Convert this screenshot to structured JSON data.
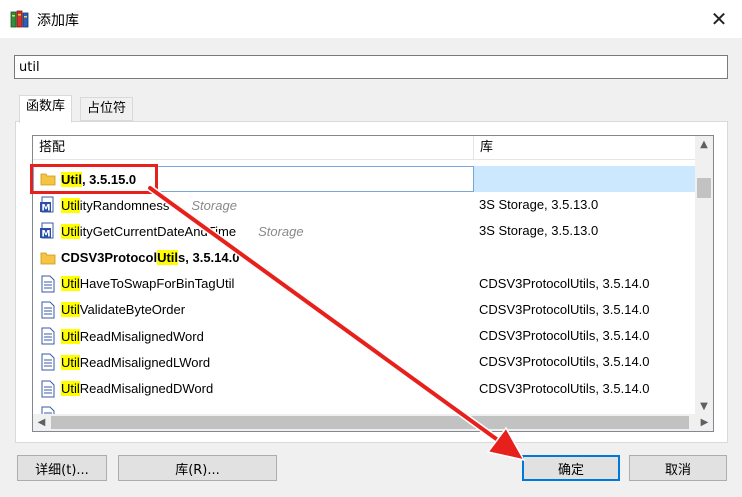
{
  "window": {
    "title": "添加库",
    "close_glyph": "✕",
    "icon": "books-icon"
  },
  "search": {
    "value": "util",
    "placeholder": ""
  },
  "tabs": [
    {
      "label": "函数库",
      "active": true
    },
    {
      "label": "占位符",
      "active": false
    }
  ],
  "list": {
    "columns": {
      "match": "搭配",
      "library": "库"
    },
    "rows": [
      {
        "icon": "folder-icon",
        "pre": "",
        "hl": "Util",
        "post": ", 3.5.15.0",
        "bold": true,
        "hint": "",
        "lib": "",
        "selected": true
      },
      {
        "icon": "method-icon",
        "pre": "",
        "hl": "Util",
        "post": "ityRandomness",
        "bold": false,
        "hint": "Storage",
        "lib": "3S Storage, 3.5.13.0",
        "selected": false
      },
      {
        "icon": "method-icon",
        "pre": "",
        "hl": "Util",
        "post": "ityGetCurrentDateAndTime",
        "bold": false,
        "hint": "Storage",
        "lib": "3S Storage, 3.5.13.0",
        "selected": false
      },
      {
        "icon": "folder-icon",
        "pre": "CDSV3Protocol",
        "hl": "Util",
        "post": "s, 3.5.14.0",
        "bold": true,
        "hint": "",
        "lib": "",
        "selected": false
      },
      {
        "icon": "document-icon",
        "pre": "",
        "hl": "Util",
        "post": "HaveToSwapForBinTagUtil",
        "bold": false,
        "hint": "",
        "lib": "CDSV3ProtocolUtils, 3.5.14.0",
        "selected": false
      },
      {
        "icon": "document-icon",
        "pre": "",
        "hl": "Util",
        "post": "ValidateByteOrder",
        "bold": false,
        "hint": "",
        "lib": "CDSV3ProtocolUtils, 3.5.14.0",
        "selected": false
      },
      {
        "icon": "document-icon",
        "pre": "",
        "hl": "Util",
        "post": "ReadMisalignedWord",
        "bold": false,
        "hint": "",
        "lib": "CDSV3ProtocolUtils, 3.5.14.0",
        "selected": false
      },
      {
        "icon": "document-icon",
        "pre": "",
        "hl": "Util",
        "post": "ReadMisalignedLWord",
        "bold": false,
        "hint": "",
        "lib": "CDSV3ProtocolUtils, 3.5.14.0",
        "selected": false
      },
      {
        "icon": "document-icon",
        "pre": "",
        "hl": "Util",
        "post": "ReadMisalignedDWord",
        "bold": false,
        "hint": "",
        "lib": "CDSV3ProtocolUtils, 3.5.14.0",
        "selected": false
      },
      {
        "icon": "document-icon",
        "pre": "",
        "hl": "",
        "post": "",
        "bold": false,
        "hint": "",
        "lib": "",
        "selected": false
      }
    ]
  },
  "buttons": {
    "details": "详细(t)...",
    "library": "库(R)...",
    "ok": "确定",
    "cancel": "取消"
  },
  "colors": {
    "highlight": "#ffff00",
    "annotation": "#e8201c",
    "selection": "#cce8ff",
    "accent": "#0078d7"
  }
}
